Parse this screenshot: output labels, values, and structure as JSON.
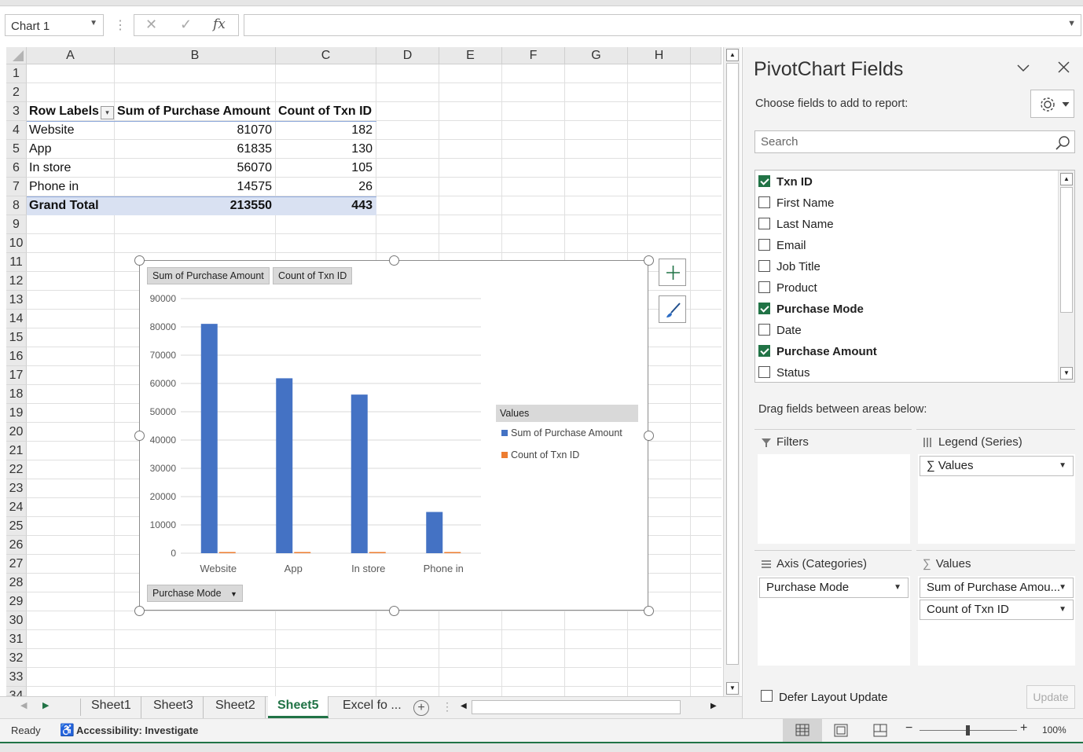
{
  "formula_bar": {
    "name_box": "Chart 1",
    "cancel_glyph": "✕",
    "enter_glyph": "✓",
    "fx_label": "fx",
    "formula": ""
  },
  "grid": {
    "columns": [
      "A",
      "B",
      "C",
      "D",
      "E",
      "F",
      "G",
      "H"
    ],
    "rows": [
      "1",
      "2",
      "3",
      "4",
      "5",
      "6",
      "7",
      "8",
      "9",
      "10",
      "11",
      "12",
      "13",
      "14",
      "15",
      "16",
      "17",
      "18",
      "19",
      "20",
      "21",
      "22",
      "23",
      "24",
      "25",
      "26",
      "27",
      "28",
      "29",
      "30",
      "31",
      "32",
      "33",
      "34"
    ]
  },
  "pivot_table": {
    "headers": [
      "Row Labels",
      "Sum of Purchase Amount",
      "Count of Txn ID"
    ],
    "rows": [
      {
        "label": "Website",
        "sum": "81070",
        "count": "182"
      },
      {
        "label": "App",
        "sum": "61835",
        "count": "130"
      },
      {
        "label": "In store",
        "sum": "56070",
        "count": "105"
      },
      {
        "label": "Phone in",
        "sum": "14575",
        "count": "26"
      }
    ],
    "total": {
      "label": "Grand Total",
      "sum": "213550",
      "count": "443"
    }
  },
  "chart_data": {
    "type": "bar",
    "title": "",
    "field_buttons": {
      "value1": "Sum of Purchase Amount",
      "value2": "Count of Txn ID",
      "axis": "Purchase Mode"
    },
    "categories": [
      "Website",
      "App",
      "In store",
      "Phone in"
    ],
    "series": [
      {
        "name": "Sum of Purchase Amount",
        "values": [
          81070,
          61835,
          56070,
          14575
        ],
        "color": "#4472c4"
      },
      {
        "name": "Count of Txn ID",
        "values": [
          182,
          130,
          105,
          26
        ],
        "color": "#ed7d31"
      }
    ],
    "y_ticks": [
      "90000",
      "80000",
      "70000",
      "60000",
      "50000",
      "40000",
      "30000",
      "20000",
      "10000",
      "0"
    ],
    "ylim": [
      0,
      90000
    ],
    "legend_title": "Values",
    "legend_position": "right",
    "grid": true
  },
  "sheet_tabs": [
    "Sheet1",
    "Sheet3",
    "Sheet2",
    "Sheet5",
    "Excel fo ..."
  ],
  "active_tab": "Sheet5",
  "status": {
    "ready": "Ready",
    "accessibility": "Accessibility: Investigate",
    "zoom": "100%"
  },
  "pane": {
    "title": "PivotChart Fields",
    "choose_label": "Choose fields to add to report:",
    "search_placeholder": "Search",
    "fields": [
      {
        "name": "Txn ID",
        "checked": true
      },
      {
        "name": "First Name",
        "checked": false
      },
      {
        "name": "Last Name",
        "checked": false
      },
      {
        "name": "Email",
        "checked": false
      },
      {
        "name": "Job Title",
        "checked": false
      },
      {
        "name": "Product",
        "checked": false
      },
      {
        "name": "Purchase Mode",
        "checked": true
      },
      {
        "name": "Date",
        "checked": false
      },
      {
        "name": "Purchase Amount",
        "checked": true
      },
      {
        "name": "Status",
        "checked": false
      }
    ],
    "drag_label": "Drag fields between areas below:",
    "areas": {
      "filters": "Filters",
      "legend": "Legend (Series)",
      "legend_items": [
        "Values"
      ],
      "axis": "Axis (Categories)",
      "axis_items": [
        "Purchase Mode"
      ],
      "values": "Values",
      "values_items": [
        "Sum of Purchase Amou...",
        "Count of Txn ID"
      ]
    },
    "defer_label": "Defer Layout Update",
    "update_label": "Update"
  }
}
